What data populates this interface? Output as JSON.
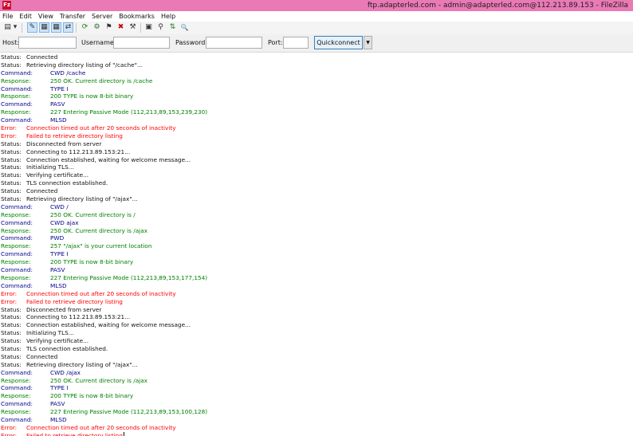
{
  "window": {
    "title": "ftp.adapterled.com - admin@adapterled.com@112.213.89.153 - FileZilla",
    "app_icon": "Fz",
    "accent": "#ea7ab5"
  },
  "menu": [
    "File",
    "Edit",
    "View",
    "Transfer",
    "Server",
    "Bookmarks",
    "Help"
  ],
  "toolbar": {
    "icons": [
      {
        "name": "site-manager-icon",
        "glyph": "▤"
      },
      {
        "name": "site-manager-dropdown-icon",
        "glyph": "▾"
      },
      {
        "name": "toggle-message-log-icon",
        "glyph": "✎",
        "pressed": true
      },
      {
        "name": "toggle-local-tree-icon",
        "glyph": "▦",
        "pressed": true
      },
      {
        "name": "toggle-remote-tree-icon",
        "glyph": "▦",
        "pressed": true
      },
      {
        "name": "toggle-transfer-queue-icon",
        "glyph": "⇄",
        "pressed": true
      },
      {
        "name": "refresh-icon",
        "glyph": "⟳"
      },
      {
        "name": "process-queue-icon",
        "glyph": "⚙"
      },
      {
        "name": "cancel-operation-icon",
        "glyph": "⚑"
      },
      {
        "name": "disconnect-icon",
        "glyph": "✖"
      },
      {
        "name": "reconnect-icon",
        "glyph": "⚒"
      },
      {
        "name": "directory-comparison-icon",
        "glyph": "▣"
      },
      {
        "name": "filter-icon",
        "glyph": "⚲"
      },
      {
        "name": "sync-browsing-icon",
        "glyph": "⇅"
      },
      {
        "name": "search-files-icon",
        "glyph": "🔍"
      }
    ]
  },
  "quickconnect": {
    "host_label": "Host:",
    "host_value": "",
    "username_label": "Username:",
    "username_value": "",
    "password_label": "Password:",
    "password_value": "",
    "port_label": "Port:",
    "port_value": "",
    "button_label": "Quickconnect",
    "dropdown_glyph": "▼"
  },
  "colors": {
    "status": "#111111",
    "command": "#00008b",
    "response": "#008000",
    "error": "#ff0000"
  },
  "log": [
    {
      "type": "status",
      "label": "Status:",
      "text": "Connected"
    },
    {
      "type": "status",
      "label": "Status:",
      "text": "Retrieving directory listing of \"/cache\"..."
    },
    {
      "type": "command",
      "label": "Command:",
      "text": "CWD /cache"
    },
    {
      "type": "response",
      "label": "Response:",
      "text": "250 OK. Current directory is /cache"
    },
    {
      "type": "command",
      "label": "Command:",
      "text": "TYPE I"
    },
    {
      "type": "response",
      "label": "Response:",
      "text": "200 TYPE is now 8-bit binary"
    },
    {
      "type": "command",
      "label": "Command:",
      "text": "PASV"
    },
    {
      "type": "response",
      "label": "Response:",
      "text": "227 Entering Passive Mode (112,213,89,153,239,230)"
    },
    {
      "type": "command",
      "label": "Command:",
      "text": "MLSD"
    },
    {
      "type": "error",
      "label": "Error:",
      "text": "Connection timed out after 20 seconds of inactivity"
    },
    {
      "type": "error",
      "label": "Error:",
      "text": "Failed to retrieve directory listing"
    },
    {
      "type": "status",
      "label": "Status:",
      "text": "Disconnected from server"
    },
    {
      "type": "status",
      "label": "Status:",
      "text": "Connecting to 112.213.89.153:21..."
    },
    {
      "type": "status",
      "label": "Status:",
      "text": "Connection established, waiting for welcome message..."
    },
    {
      "type": "status",
      "label": "Status:",
      "text": "Initializing TLS..."
    },
    {
      "type": "status",
      "label": "Status:",
      "text": "Verifying certificate..."
    },
    {
      "type": "status",
      "label": "Status:",
      "text": "TLS connection established."
    },
    {
      "type": "status",
      "label": "Status:",
      "text": "Connected"
    },
    {
      "type": "status",
      "label": "Status:",
      "text": "Retrieving directory listing of \"/ajax\"..."
    },
    {
      "type": "command",
      "label": "Command:",
      "text": "CWD /"
    },
    {
      "type": "response",
      "label": "Response:",
      "text": "250 OK. Current directory is /"
    },
    {
      "type": "command",
      "label": "Command:",
      "text": "CWD ajax"
    },
    {
      "type": "response",
      "label": "Response:",
      "text": "250 OK. Current directory is /ajax"
    },
    {
      "type": "command",
      "label": "Command:",
      "text": "PWD"
    },
    {
      "type": "response",
      "label": "Response:",
      "text": "257 \"/ajax\" is your current location"
    },
    {
      "type": "command",
      "label": "Command:",
      "text": "TYPE I"
    },
    {
      "type": "response",
      "label": "Response:",
      "text": "200 TYPE is now 8-bit binary"
    },
    {
      "type": "command",
      "label": "Command:",
      "text": "PASV"
    },
    {
      "type": "response",
      "label": "Response:",
      "text": "227 Entering Passive Mode (112,213,89,153,177,154)"
    },
    {
      "type": "command",
      "label": "Command:",
      "text": "MLSD"
    },
    {
      "type": "error",
      "label": "Error:",
      "text": "Connection timed out after 20 seconds of inactivity"
    },
    {
      "type": "error",
      "label": "Error:",
      "text": "Failed to retrieve directory listing"
    },
    {
      "type": "status",
      "label": "Status:",
      "text": "Disconnected from server"
    },
    {
      "type": "status",
      "label": "Status:",
      "text": "Connecting to 112.213.89.153:21..."
    },
    {
      "type": "status",
      "label": "Status:",
      "text": "Connection established, waiting for welcome message..."
    },
    {
      "type": "status",
      "label": "Status:",
      "text": "Initializing TLS..."
    },
    {
      "type": "status",
      "label": "Status:",
      "text": "Verifying certificate..."
    },
    {
      "type": "status",
      "label": "Status:",
      "text": "TLS connection established."
    },
    {
      "type": "status",
      "label": "Status:",
      "text": "Connected"
    },
    {
      "type": "status",
      "label": "Status:",
      "text": "Retrieving directory listing of \"/ajax\"..."
    },
    {
      "type": "command",
      "label": "Command:",
      "text": "CWD /ajax"
    },
    {
      "type": "response",
      "label": "Response:",
      "text": "250 OK. Current directory is /ajax"
    },
    {
      "type": "command",
      "label": "Command:",
      "text": "TYPE I"
    },
    {
      "type": "response",
      "label": "Response:",
      "text": "200 TYPE is now 8-bit binary"
    },
    {
      "type": "command",
      "label": "Command:",
      "text": "PASV"
    },
    {
      "type": "response",
      "label": "Response:",
      "text": "227 Entering Passive Mode (112,213,89,153,100,128)"
    },
    {
      "type": "command",
      "label": "Command:",
      "text": "MLSD"
    },
    {
      "type": "error",
      "label": "Error:",
      "text": "Connection timed out after 20 seconds of inactivity"
    },
    {
      "type": "error",
      "label": "Error:",
      "text": "Failed to retrieve directory listing"
    }
  ]
}
